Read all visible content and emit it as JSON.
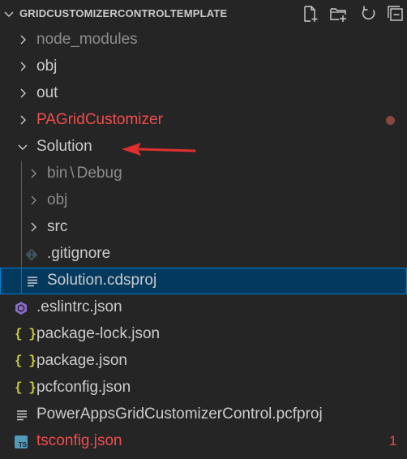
{
  "explorer": {
    "section_title": "GRIDCUSTOMIZERCONTROLTEMPLATE",
    "toolbar": [
      "new-file-icon",
      "new-folder-icon",
      "refresh-icon",
      "collapse-all-icon"
    ]
  },
  "tree": {
    "node_modules": "node_modules",
    "obj": "obj",
    "out": "out",
    "pagridcustomizer": "PAGridCustomizer",
    "solution": "Solution",
    "solution_bin": "bin",
    "solution_bin_sep": "\\",
    "solution_bin_debug": "Debug",
    "solution_obj": "obj",
    "solution_src": "src",
    "solution_gitignore": ".gitignore",
    "solution_cdsproj": "Solution.cdsproj",
    "eslintrc": ".eslintrc.json",
    "package_lock": "package-lock.json",
    "package": "package.json",
    "pcfconfig": "pcfconfig.json",
    "pcfproj": "PowerAppsGridCustomizerControl.pcfproj",
    "tsconfig": "tsconfig.json",
    "tsconfig_problems": "1",
    "json_icon_glyph": "{ }",
    "ts_icon_glyph": "TS"
  },
  "colors": {
    "background": "#252526",
    "selection": "#04395e",
    "selection_border": "#007fd4",
    "error_text": "#f14c4c",
    "modified_dot": "#88483f",
    "json_icon": "#cbcb41",
    "ts_icon": "#519aba",
    "eslint_icon": "#8a6cc9",
    "annotation_arrow": "#e02f2f"
  }
}
